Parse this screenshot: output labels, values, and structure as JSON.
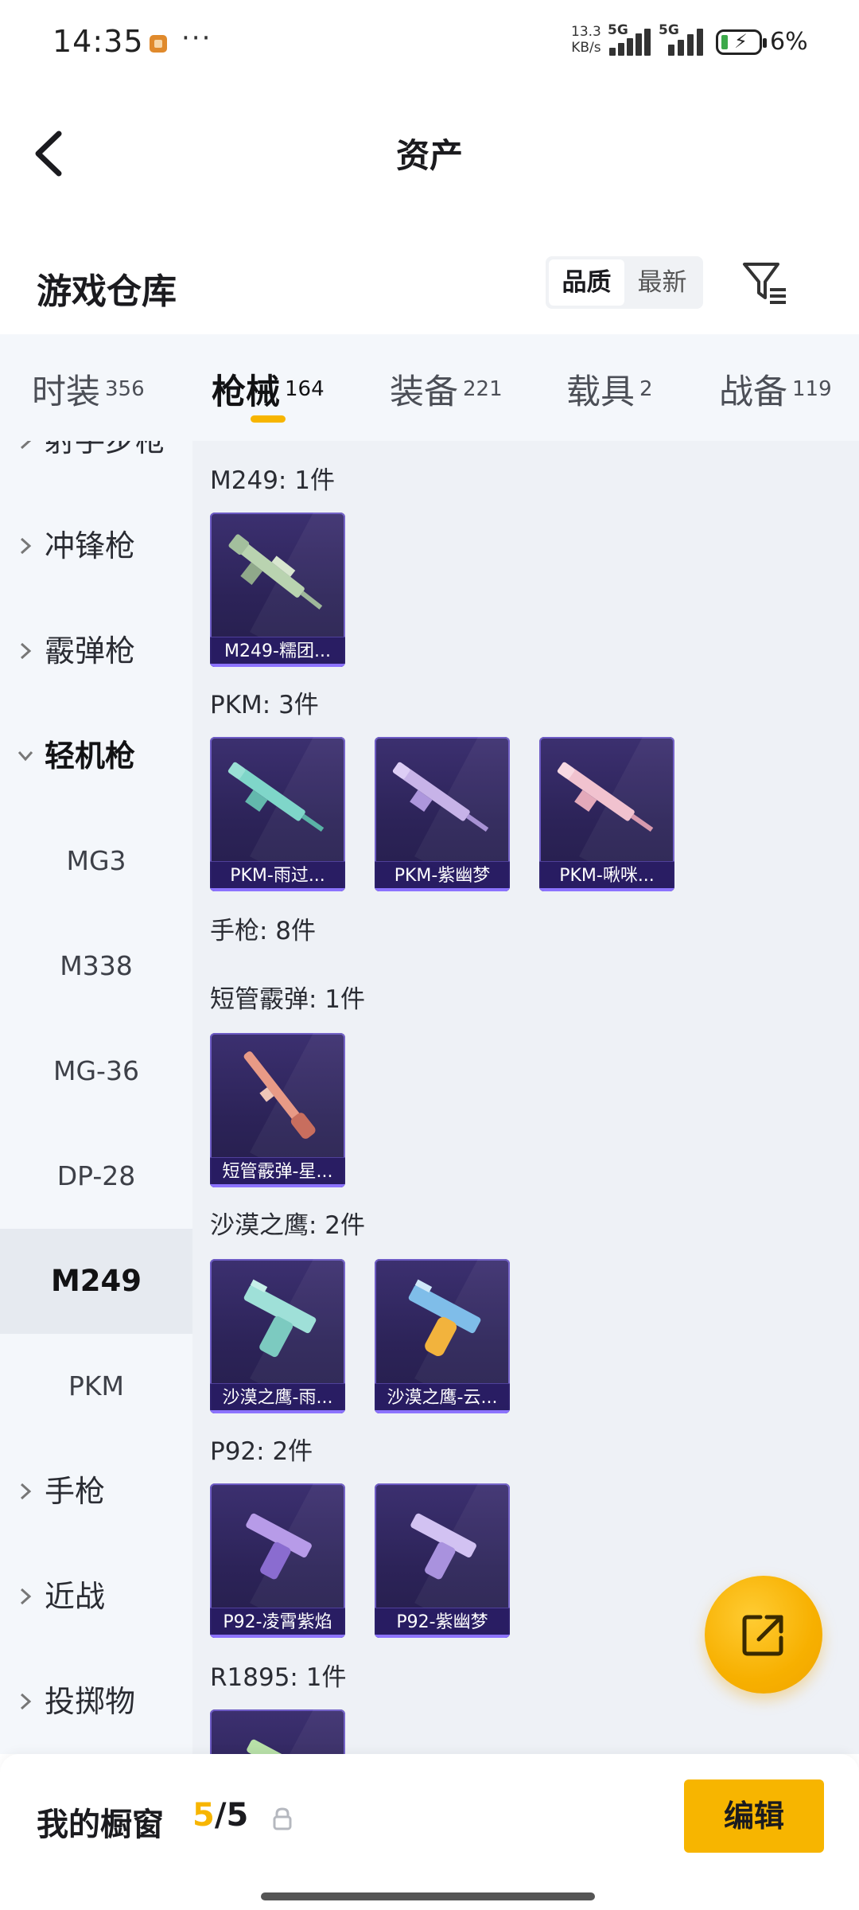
{
  "status_bar": {
    "time": "14:35",
    "dots": "···",
    "speed_value": "13.3",
    "speed_unit": "KB/s",
    "signal_1": "5G",
    "signal_2": "5G",
    "battery": "6%",
    "battery_color": "#3ca94a"
  },
  "header": {
    "title": "资产",
    "back_icon": "chevron-left-icon"
  },
  "section": {
    "title": "游戏仓库",
    "sort_options": [
      "品质",
      "最新"
    ],
    "sort_selected": "品质",
    "filter_icon": "filter-icon"
  },
  "tabs": [
    {
      "label": "时装",
      "count": "356"
    },
    {
      "label": "枪械",
      "count": "164",
      "active": true
    },
    {
      "label": "装备",
      "count": "221"
    },
    {
      "label": "载具",
      "count": "2"
    },
    {
      "label": "战备",
      "count": "119"
    }
  ],
  "sidebar": {
    "items": [
      {
        "label": "射手步枪",
        "type": "category"
      },
      {
        "label": "冲锋枪",
        "type": "category"
      },
      {
        "label": "霰弹枪",
        "type": "category"
      },
      {
        "label": "轻机枪",
        "type": "category",
        "expanded": true
      },
      {
        "label": "MG3",
        "type": "sub"
      },
      {
        "label": "M338",
        "type": "sub"
      },
      {
        "label": "MG-36",
        "type": "sub"
      },
      {
        "label": "DP-28",
        "type": "sub"
      },
      {
        "label": "M249",
        "type": "sub",
        "selected": true
      },
      {
        "label": "PKM",
        "type": "sub"
      },
      {
        "label": "手枪",
        "type": "category"
      },
      {
        "label": "近战",
        "type": "category"
      },
      {
        "label": "投掷物",
        "type": "category"
      }
    ]
  },
  "groups": [
    {
      "title": "M249: 1件",
      "items": [
        "M249-糯团..."
      ]
    },
    {
      "title": "PKM: 3件",
      "items": [
        "PKM-雨过...",
        "PKM-紫幽梦",
        "PKM-啾咪..."
      ]
    },
    {
      "title": "手枪: 8件",
      "items": []
    },
    {
      "title": "短管霰弹: 1件",
      "items": [
        "短管霰弹-星..."
      ]
    },
    {
      "title": "沙漠之鹰: 2件",
      "items": [
        "沙漠之鹰-雨...",
        "沙漠之鹰-云..."
      ]
    },
    {
      "title": "P92: 2件",
      "items": [
        "P92-凌霄紫焰",
        "P92-紫幽梦"
      ]
    },
    {
      "title": "R1895: 1件",
      "items": [
        ""
      ]
    }
  ],
  "fab": {
    "icon": "share-external-icon",
    "color": "#f7b500"
  },
  "bottom_bar": {
    "title": "我的橱窗",
    "count_current": "5",
    "count_sep": "/",
    "count_total": "5",
    "lock_icon": "lock-icon",
    "edit_label": "编辑",
    "accent": "#f7b500"
  }
}
